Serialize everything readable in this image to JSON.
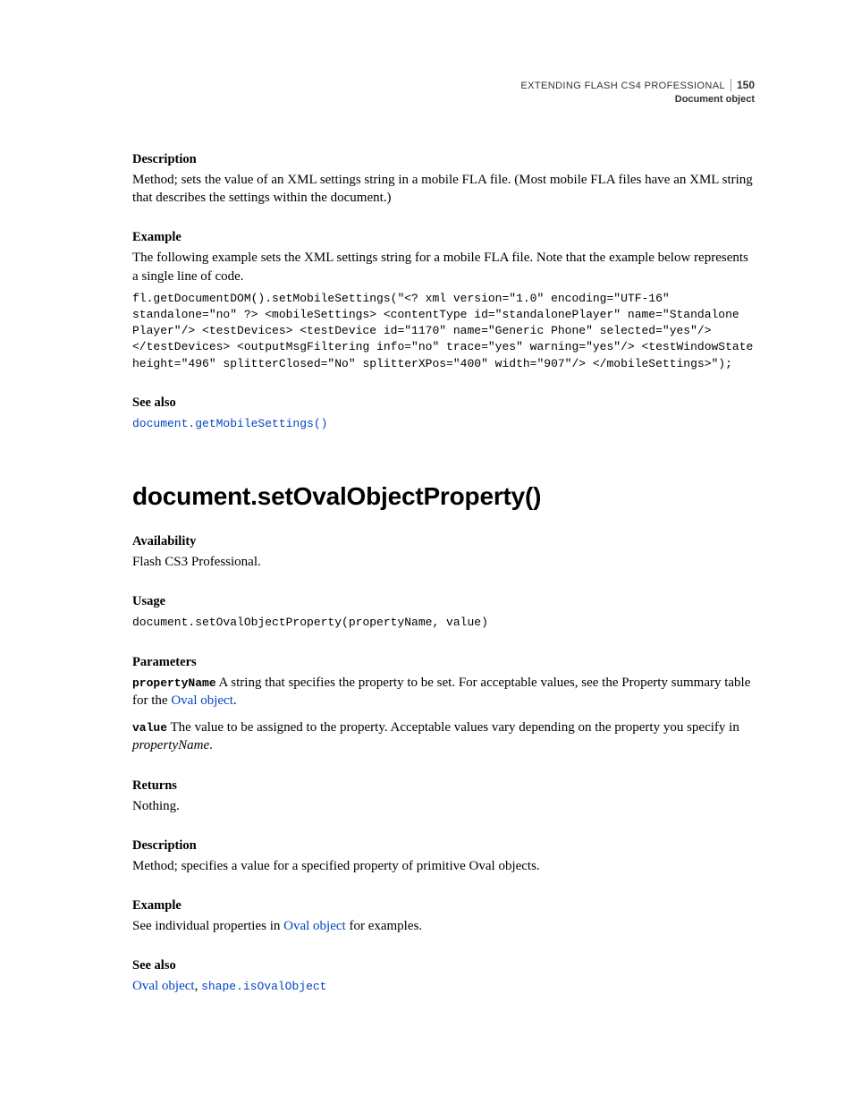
{
  "header": {
    "doc_title": "EXTENDING FLASH CS4 PROFESSIONAL",
    "page_number": "150",
    "section": "Document object"
  },
  "sec1": {
    "h_description": "Description",
    "description_text": "Method; sets the value of an XML settings string in a mobile FLA file. (Most mobile FLA files have an XML string that describes the settings within the document.)",
    "h_example": "Example",
    "example_intro": "The following example sets the XML settings string for a mobile FLA file. Note that the example below represents a single line of code.",
    "example_code": "fl.getDocumentDOM().setMobileSettings(\"<? xml version=\"1.0\" encoding=\"UTF-16\" standalone=\"no\" ?> <mobileSettings> <contentType id=\"standalonePlayer\" name=\"Standalone Player\"/> <testDevices> <testDevice id=\"1170\" name=\"Generic Phone\" selected=\"yes\"/> </testDevices> <outputMsgFiltering info=\"no\" trace=\"yes\" warning=\"yes\"/> <testWindowState height=\"496\" splitterClosed=\"No\" splitterXPos=\"400\" width=\"907\"/> </mobileSettings>\");",
    "h_seealso": "See also",
    "seealso_link": "document.getMobileSettings()"
  },
  "api": {
    "title": "document.setOvalObjectProperty()",
    "h_availability": "Availability",
    "availability_text": "Flash CS3 Professional.",
    "h_usage": "Usage",
    "usage_code": "document.setOvalObjectProperty(propertyName, value)",
    "h_parameters": "Parameters",
    "param1_name": "propertyName",
    "param1_desc_a": "  A string that specifies the property to be set. For acceptable values, see the Property summary table for the ",
    "param1_link": "Oval object",
    "param1_desc_b": ".",
    "param2_name": "value",
    "param2_desc_a": "  The value to be assigned to the property. Acceptable values vary depending on the property you specify in ",
    "param2_italic": "propertyName",
    "param2_desc_b": ".",
    "h_returns": "Returns",
    "returns_text": "Nothing.",
    "h_description": "Description",
    "description_text": "Method; specifies a value for a specified property of primitive Oval objects.",
    "h_example": "Example",
    "example_pre": "See individual properties in ",
    "example_link": "Oval object",
    "example_post": " for examples.",
    "h_seealso": "See also",
    "seealso_link1": "Oval object",
    "seealso_sep": ", ",
    "seealso_link2": "shape.isOvalObject"
  }
}
